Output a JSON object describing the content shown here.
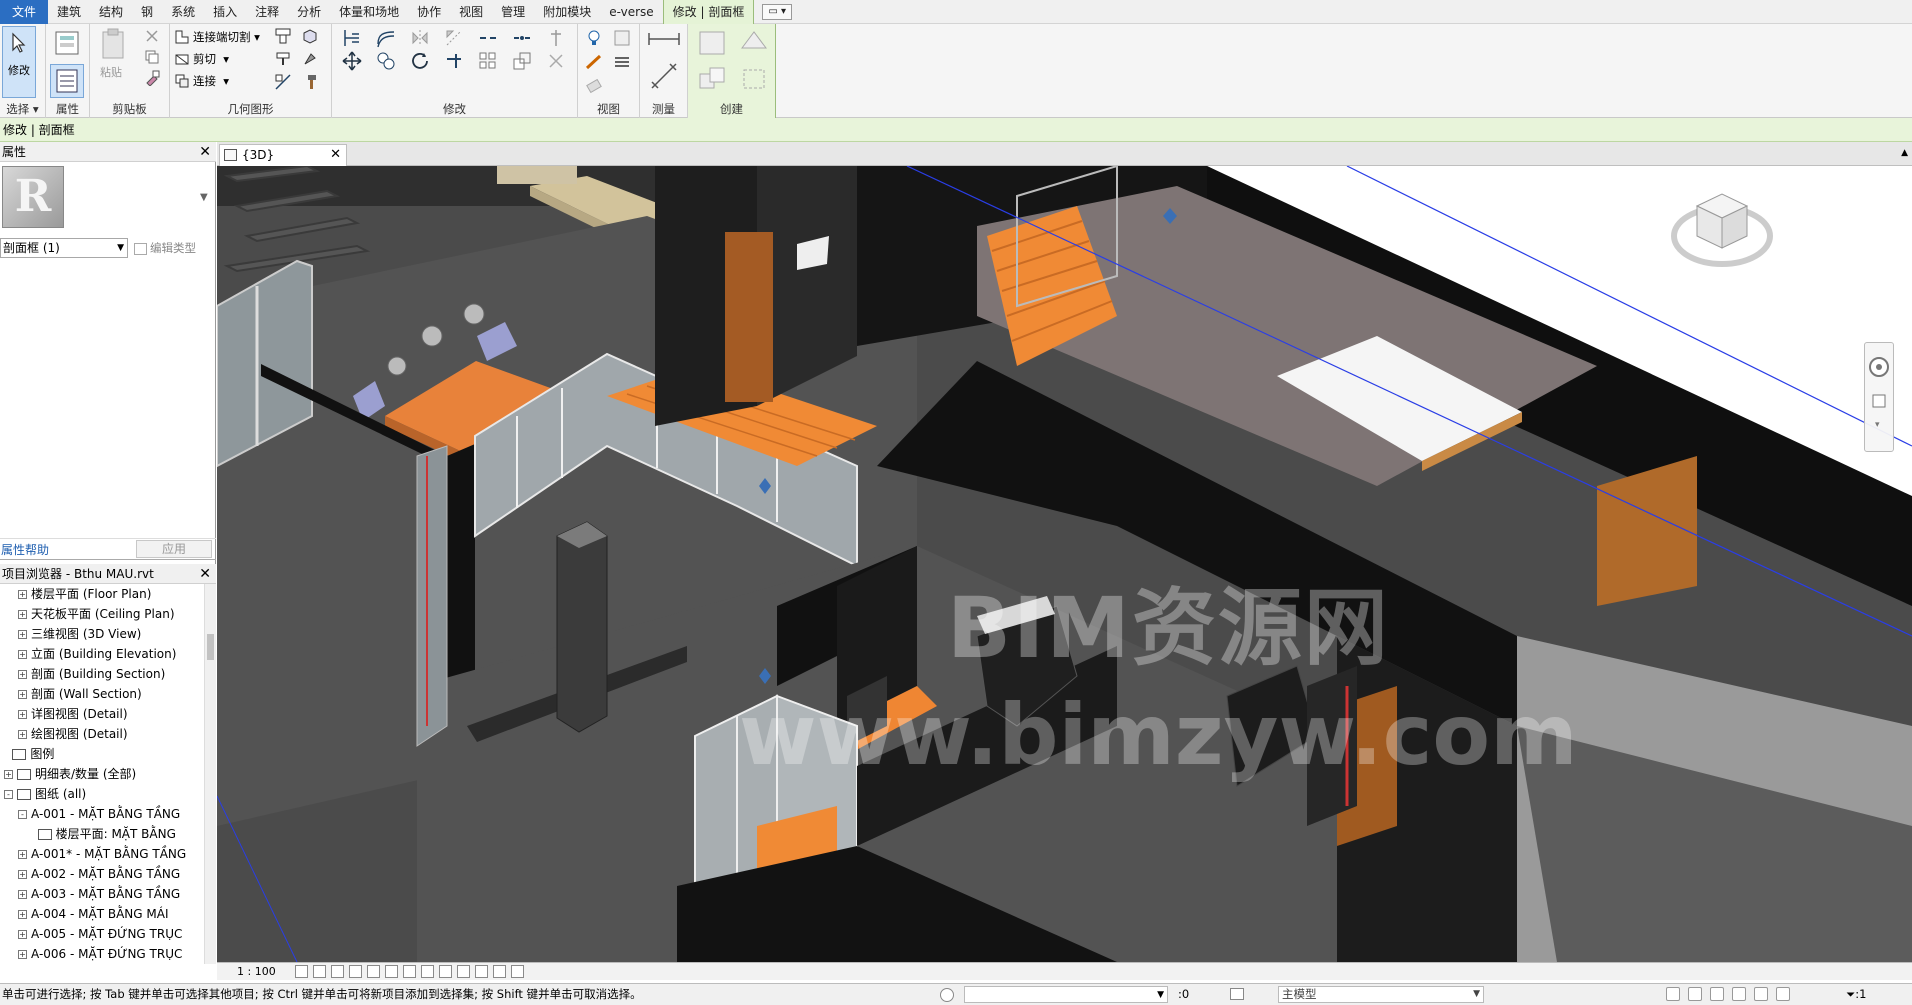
{
  "menu": {
    "tabs": [
      "文件",
      "建筑",
      "结构",
      "钢",
      "系统",
      "插入",
      "注释",
      "分析",
      "体量和场地",
      "协作",
      "视图",
      "管理",
      "附加模块",
      "e-verse"
    ],
    "context_tab": "修改 | 剖面框"
  },
  "ribbon": {
    "modify_label": "修改",
    "select_label": "选择",
    "properties_label": "属性",
    "clipboard_label": "剪贴板",
    "paste_label": "粘贴",
    "geometry_label": "几何图形",
    "connect_cut": "连接端切割",
    "cut": "剪切",
    "join": "连接",
    "modify_panel_label": "修改",
    "view_panel_label": "视图",
    "measure_panel_label": "测量",
    "create_panel_label": "创建"
  },
  "context_bar": "修改 | 剖面框",
  "properties": {
    "title": "属性",
    "type_selector": "剖面框 (1)",
    "edit_type": "编辑类型",
    "help": "属性帮助",
    "apply": "应用"
  },
  "browser": {
    "title": "项目浏览器 - Bthu MAU.rvt",
    "items": [
      {
        "label": "楼层平面 (Floor Plan)",
        "indent": 1,
        "toggle": "+",
        "icon": false
      },
      {
        "label": "天花板平面 (Ceiling Plan)",
        "indent": 1,
        "toggle": "+",
        "icon": false
      },
      {
        "label": "三维视图 (3D View)",
        "indent": 1,
        "toggle": "+",
        "icon": false
      },
      {
        "label": "立面 (Building Elevation)",
        "indent": 1,
        "toggle": "+",
        "icon": false
      },
      {
        "label": "剖面 (Building Section)",
        "indent": 1,
        "toggle": "+",
        "icon": false
      },
      {
        "label": "剖面 (Wall Section)",
        "indent": 1,
        "toggle": "+",
        "icon": false
      },
      {
        "label": "详图视图 (Detail)",
        "indent": 1,
        "toggle": "+",
        "icon": false
      },
      {
        "label": "绘图视图 (Detail)",
        "indent": 1,
        "toggle": "+",
        "icon": false
      },
      {
        "label": "图例",
        "indent": 0.6,
        "toggle": "",
        "icon": true
      },
      {
        "label": "明细表/数量 (全部)",
        "indent": 0,
        "toggle": "+",
        "icon": true
      },
      {
        "label": "图纸 (all)",
        "indent": 0,
        "toggle": "-",
        "icon": true
      },
      {
        "label": "A-001 - MẶT BẰNG TẦNG",
        "indent": 1,
        "toggle": "-",
        "icon": false
      },
      {
        "label": "楼层平面: MẶT BẰNG",
        "indent": 2.4,
        "toggle": "",
        "icon": true
      },
      {
        "label": "A-001* - MẶT BẰNG TẦNG",
        "indent": 1,
        "toggle": "+",
        "icon": false
      },
      {
        "label": "A-002 - MẶT BẰNG TẦNG",
        "indent": 1,
        "toggle": "+",
        "icon": false
      },
      {
        "label": "A-003 - MẶT BẰNG TẦNG",
        "indent": 1,
        "toggle": "+",
        "icon": false
      },
      {
        "label": "A-004 - MẶT BẰNG MÁI",
        "indent": 1,
        "toggle": "+",
        "icon": false
      },
      {
        "label": "A-005 - MẶT ĐỨNG TRỤC",
        "indent": 1,
        "toggle": "+",
        "icon": false
      },
      {
        "label": "A-006 - MẶT ĐỨNG TRỤC",
        "indent": 1,
        "toggle": "+",
        "icon": false
      }
    ]
  },
  "view": {
    "tab_label": "{3D}",
    "scale": "1 : 100",
    "watermark_text": "BIM资源网",
    "watermark_url": "www.bimzyw.com"
  },
  "status": {
    "message": "单击可进行选择; 按 Tab 键并单击可选择其他项目; 按 Ctrl 键并单击可将新项目添加到选择集; 按 Shift 键并单击可取消选择。",
    "zero": ":0",
    "model": "主模型",
    "filter": ":1"
  },
  "colors": {
    "accent": "#2b6ec2",
    "context_green": "#e8f4da",
    "wall_dark": "#1a1a1a",
    "floor_gray": "#5a5a5a",
    "wood_orange": "#e87d2a"
  }
}
